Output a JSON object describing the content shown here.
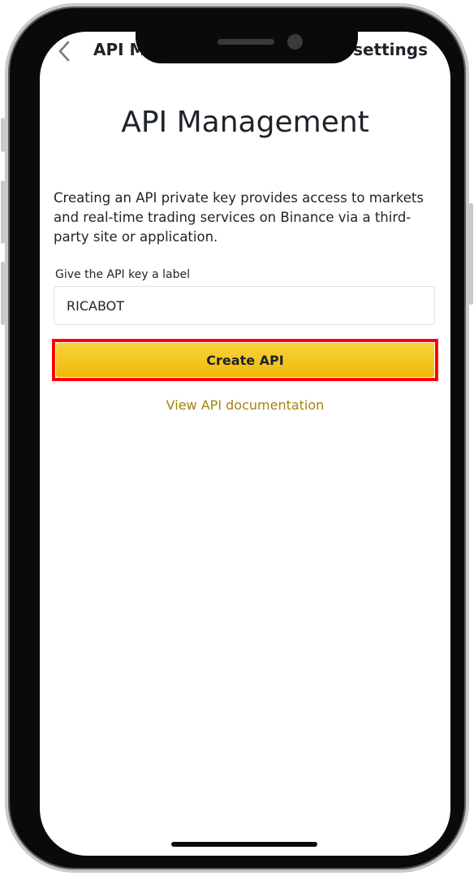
{
  "nav": {
    "back_icon": "chevron-left-icon",
    "title_left": "API M",
    "title_right": "-settings"
  },
  "page": {
    "title": "API Management",
    "description": "Creating an API private key provides access to markets and real-time trading services on Binance via a third-party site or application."
  },
  "form": {
    "label": "Give the API key a label",
    "input_value": "RICABOT",
    "create_button": "Create API",
    "doc_link": "View API documentation"
  },
  "colors": {
    "accent": "#f0b90b",
    "link": "#a1850f",
    "highlight": "#ff0000",
    "text": "#1e2329"
  }
}
